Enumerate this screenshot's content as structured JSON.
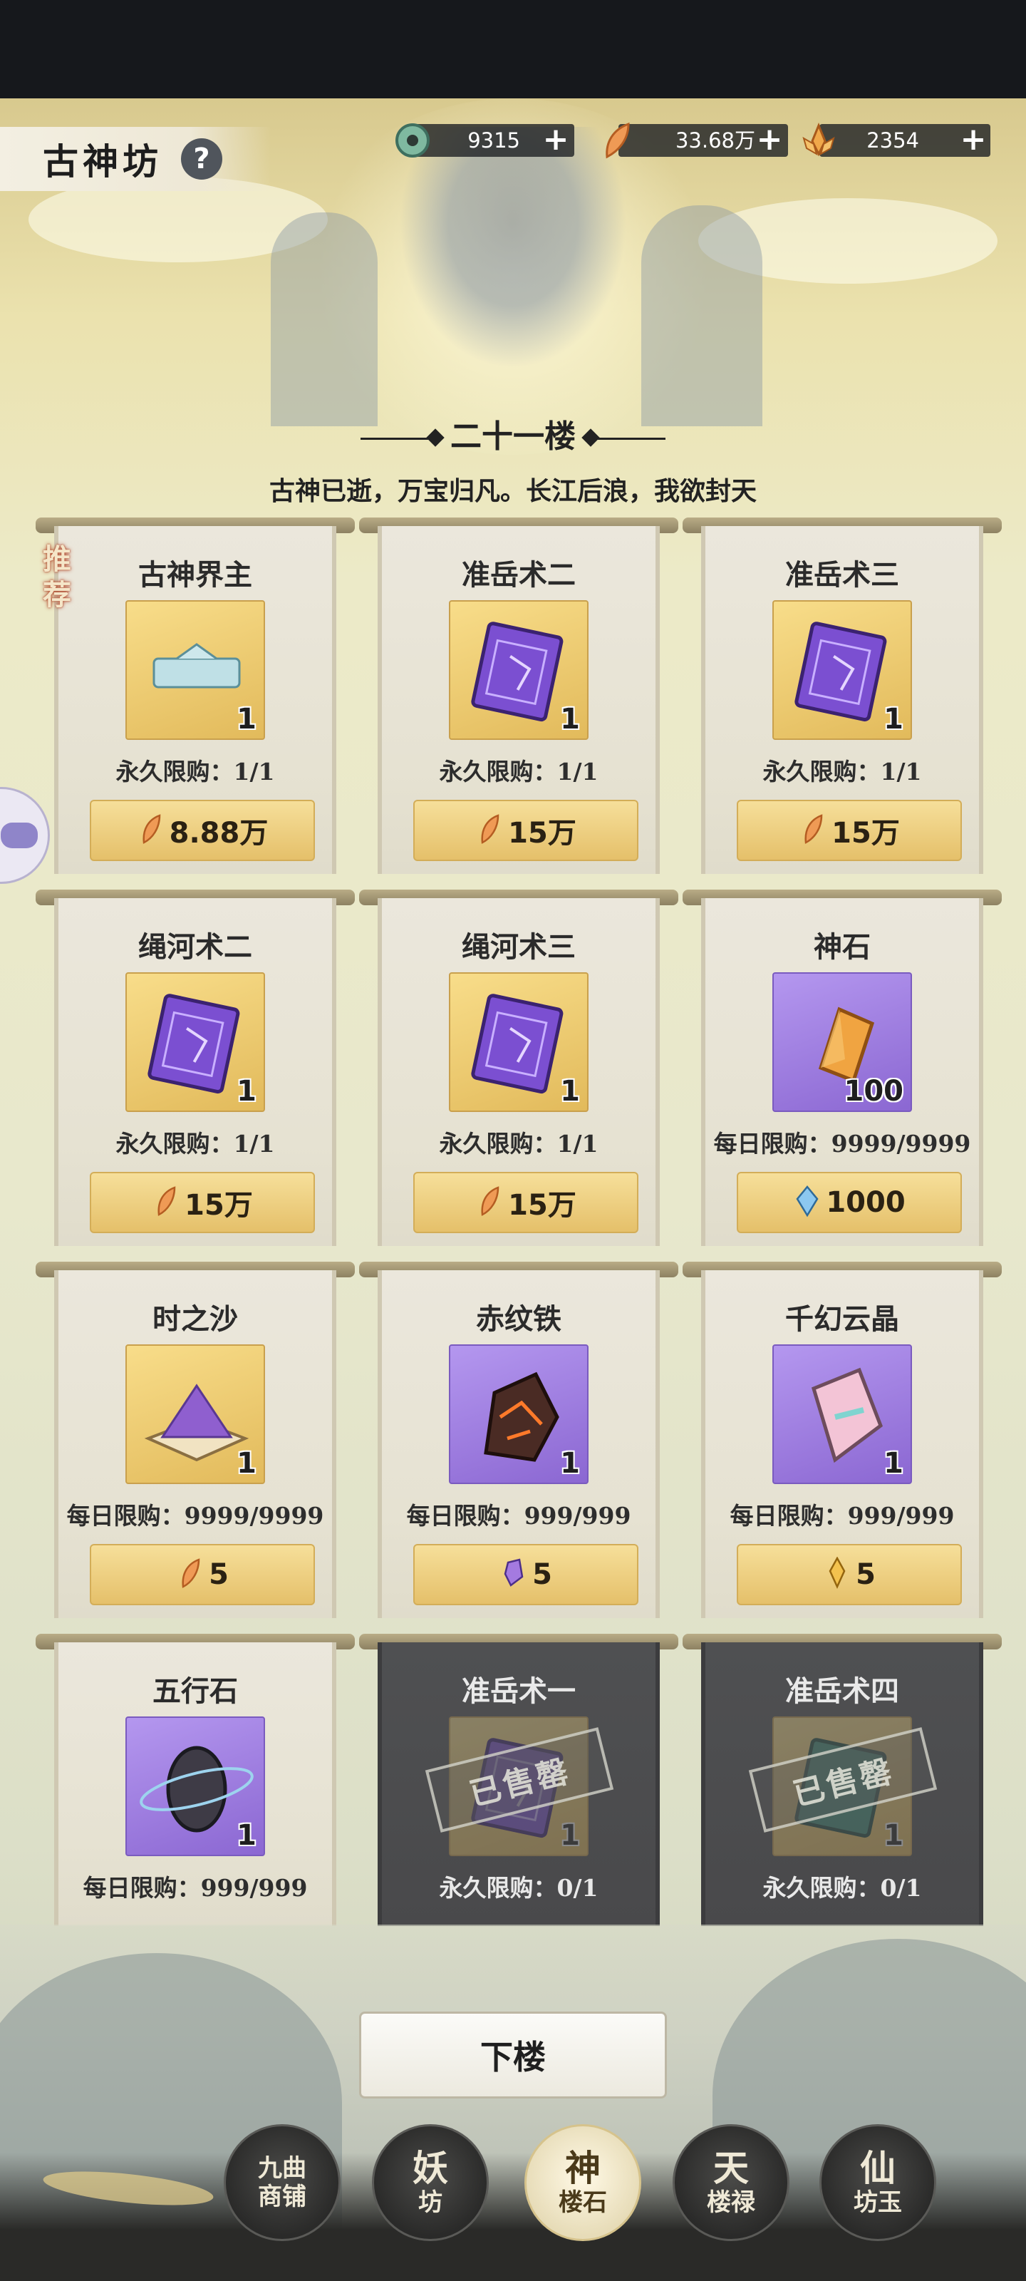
{
  "header": {
    "title": "古神坊",
    "help_glyph": "?"
  },
  "currencies": [
    {
      "icon": "jade-coin-icon",
      "value": "9315",
      "plus": "+"
    },
    {
      "icon": "feather-icon",
      "value": "33.68万",
      "plus": "+"
    },
    {
      "icon": "lotus-crystal-icon",
      "value": "2354",
      "plus": "+"
    }
  ],
  "floor": {
    "title": "二十一楼",
    "subtitle": "古神已逝，万宝归凡。长江后浪，我欲封天",
    "recommend_label": "推荐"
  },
  "items": [
    {
      "name": "古神界主",
      "qty": "1",
      "limit": "永久限购：1/1",
      "price": "8.88万",
      "price_icon": "feather-icon",
      "item_icon": "title-plaque-icon",
      "frame": "gold",
      "sold_out": false
    },
    {
      "name": "准岳术二",
      "qty": "1",
      "limit": "永久限购：1/1",
      "price": "15万",
      "price_icon": "feather-icon",
      "item_icon": "purple-book-icon",
      "frame": "gold",
      "sold_out": false
    },
    {
      "name": "准岳术三",
      "qty": "1",
      "limit": "永久限购：1/1",
      "price": "15万",
      "price_icon": "feather-icon",
      "item_icon": "purple-book-icon",
      "frame": "gold",
      "sold_out": false
    },
    {
      "name": "绳河术二",
      "qty": "1",
      "limit": "永久限购：1/1",
      "price": "15万",
      "price_icon": "feather-icon",
      "item_icon": "purple-book-icon",
      "frame": "gold",
      "sold_out": false
    },
    {
      "name": "绳河术三",
      "qty": "1",
      "limit": "永久限购：1/1",
      "price": "15万",
      "price_icon": "feather-icon",
      "item_icon": "purple-book-icon",
      "frame": "gold",
      "sold_out": false
    },
    {
      "name": "神石",
      "qty": "100",
      "limit": "每日限购：9999/9999",
      "price": "1000",
      "price_icon": "blue-crystal-icon",
      "item_icon": "amber-crystal-icon",
      "frame": "purple",
      "sold_out": false
    },
    {
      "name": "时之沙",
      "qty": "1",
      "limit": "每日限购：9999/9999",
      "price": "5",
      "price_icon": "feather-icon",
      "item_icon": "sand-box-icon",
      "frame": "gold",
      "sold_out": false
    },
    {
      "name": "赤纹铁",
      "qty": "1",
      "limit": "每日限购：999/999",
      "price": "5",
      "price_icon": "purple-shard-icon",
      "item_icon": "ore-icon",
      "frame": "purple",
      "sold_out": false
    },
    {
      "name": "千幻云晶",
      "qty": "1",
      "limit": "每日限购：999/999",
      "price": "5",
      "price_icon": "gold-crystal-icon",
      "item_icon": "pink-crystal-icon",
      "frame": "purple",
      "sold_out": false
    },
    {
      "name": "五行石",
      "qty": "1",
      "limit": "每日限购：999/999",
      "price": "",
      "price_icon": "",
      "item_icon": "ringed-stone-icon",
      "frame": "purple",
      "sold_out": false
    },
    {
      "name": "准岳术一",
      "qty": "1",
      "limit": "永久限购：0/1",
      "price": "",
      "price_icon": "",
      "item_icon": "purple-book-icon",
      "frame": "gold",
      "sold_out": true
    },
    {
      "name": "准岳术四",
      "qty": "1",
      "limit": "永久限购：0/1",
      "price": "",
      "price_icon": "",
      "item_icon": "green-book-icon",
      "frame": "gold",
      "sold_out": true
    }
  ],
  "sold_out_label": "已售罄",
  "down_button": "下楼",
  "nav": [
    {
      "line1": "九曲",
      "line2": "商铺",
      "active": false
    },
    {
      "line1": "妖",
      "line2": "坊",
      "active": false
    },
    {
      "line1": "神",
      "line2": "楼石",
      "active": true
    },
    {
      "line1": "天",
      "line2": "楼禄",
      "active": false
    },
    {
      "line1": "仙",
      "line2": "坊玉",
      "active": false
    }
  ],
  "colors": {
    "gold_frame": "#e2ba5b",
    "purple_frame": "#8b67d2",
    "sold_out_bg": "#4f5052",
    "price_button": "#f0d385"
  }
}
